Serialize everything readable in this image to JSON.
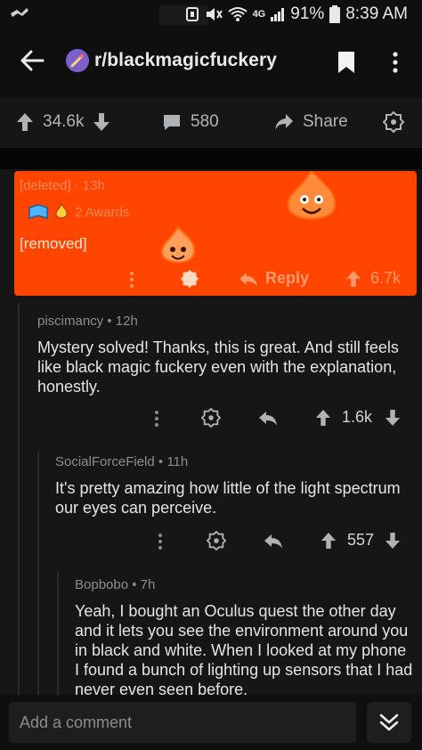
{
  "status_bar": {
    "battery": "91%",
    "time": "8:39 AM",
    "network": "4G"
  },
  "header": {
    "subreddit": "r/blackmagicfuckery"
  },
  "post_actions": {
    "upvotes": "34.6k",
    "comments": "580",
    "share_label": "Share"
  },
  "deleted_comment": {
    "author": "[deleted]",
    "age": "13h",
    "awards": "2 Awards",
    "body": "[removed]",
    "reply_label": "Reply",
    "score": "6.7k"
  },
  "comments": [
    {
      "author": "piscimancy",
      "age": "12h",
      "body": "Mystery solved! Thanks, this is great. And still feels like black magic fuckery even with the explanation, honestly.",
      "score": "1.6k"
    },
    {
      "author": "SocialForceField",
      "age": "11h",
      "body": "It's pretty amazing how little of the light spectrum our eyes can perceive.",
      "score": "557"
    },
    {
      "author": "Bopbobo",
      "age": "7h",
      "body": "Yeah, I bought an Oculus quest the other day and it lets you see the environment around you in black and white. When I looked at my phone I found a bunch of lighting up sensors that I had never even seen before."
    }
  ],
  "composer": {
    "placeholder": "Add a comment"
  },
  "colors": {
    "highlight": "#ff4500",
    "background": "#161616"
  }
}
